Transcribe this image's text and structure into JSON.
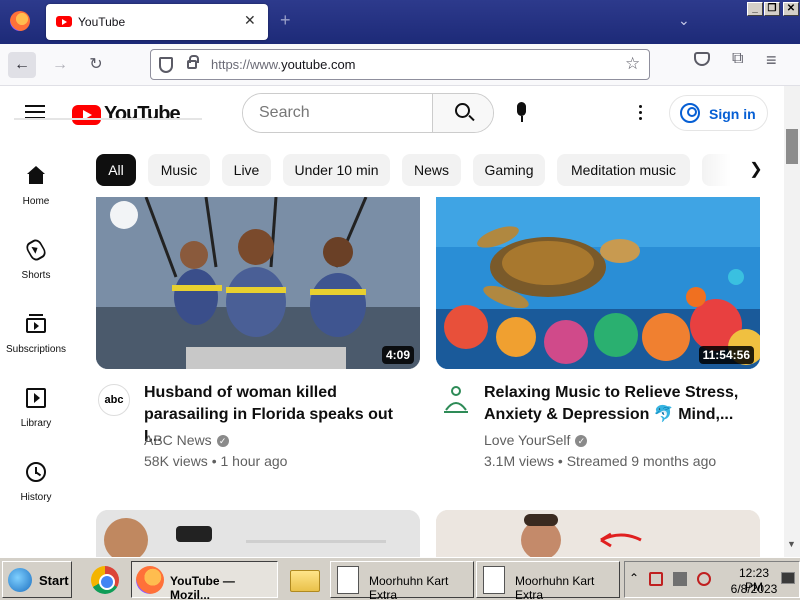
{
  "browser": {
    "tab_title": "YouTube",
    "url_prefix": "https://www.",
    "url_domain": "youtube.com"
  },
  "youtube": {
    "logo_text": "YouTube",
    "search_placeholder": "Search",
    "sign_in_label": "Sign in",
    "sidebar": [
      {
        "label": "Home"
      },
      {
        "label": "Shorts"
      },
      {
        "label": "Subscriptions"
      },
      {
        "label": "Library"
      },
      {
        "label": "History"
      }
    ],
    "chips": [
      {
        "label": "All"
      },
      {
        "label": "Music"
      },
      {
        "label": "Live"
      },
      {
        "label": "Under 10 min"
      },
      {
        "label": "News"
      },
      {
        "label": "Gaming"
      },
      {
        "label": "Meditation music"
      }
    ],
    "videos": [
      {
        "title_line1": "Husband of woman killed",
        "title_line2": "parasailing in Florida speaks out I...",
        "channel": "ABC News",
        "views": "58K views",
        "age": "1 hour ago",
        "duration": "4:09",
        "avatar_text": "abc"
      },
      {
        "title_line1": "Relaxing Music to Relieve Stress,",
        "title_line2": "Anxiety & Depression 🐬 Mind,...",
        "channel": "Love YourSelf",
        "views": "3.1M views",
        "age": "Streamed 9 months ago",
        "duration": "11:54:56"
      }
    ],
    "meta_separator": "•"
  },
  "taskbar": {
    "start_label": "Start",
    "firefox_item": "YouTube — Mozil...",
    "item_3": "Moorhuhn Kart Extra",
    "item_4": "Moorhuhn Kart Extra",
    "clock_time": "12:23 PM",
    "clock_date": "6/8/2023"
  },
  "colors": {
    "yt_red": "#ff0000",
    "link_blue": "#065fd4"
  }
}
